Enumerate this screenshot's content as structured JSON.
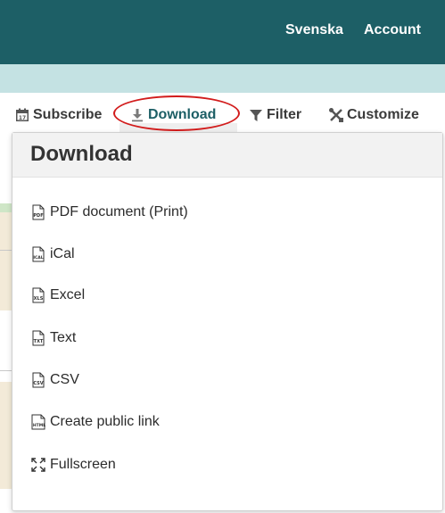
{
  "header": {
    "language_link": "Svenska",
    "account_link": "Account",
    "bg_color": "#1d5f66",
    "subbar_color": "#c4e2e3"
  },
  "toolbar": {
    "subscribe": "Subscribe",
    "download": "Download",
    "filter": "Filter",
    "customize": "Customize",
    "active_color": "#1d5f66",
    "highlight_color": "#d21c1c"
  },
  "dropdown": {
    "title": "Download",
    "items": [
      {
        "label": "PDF document (Print)",
        "icon": "pdf-file-icon",
        "tag": "PDF"
      },
      {
        "label": "iCal",
        "icon": "ical-file-icon",
        "tag": "ICAL"
      },
      {
        "label": "Excel",
        "icon": "xls-file-icon",
        "tag": "XLS"
      },
      {
        "label": "Text",
        "icon": "txt-file-icon",
        "tag": "TXT"
      },
      {
        "label": "CSV",
        "icon": "csv-file-icon",
        "tag": "CSV"
      },
      {
        "label": "Create public link",
        "icon": "html-file-icon",
        "tag": "HTML"
      },
      {
        "label": "Fullscreen",
        "icon": "fullscreen-icon"
      }
    ]
  }
}
